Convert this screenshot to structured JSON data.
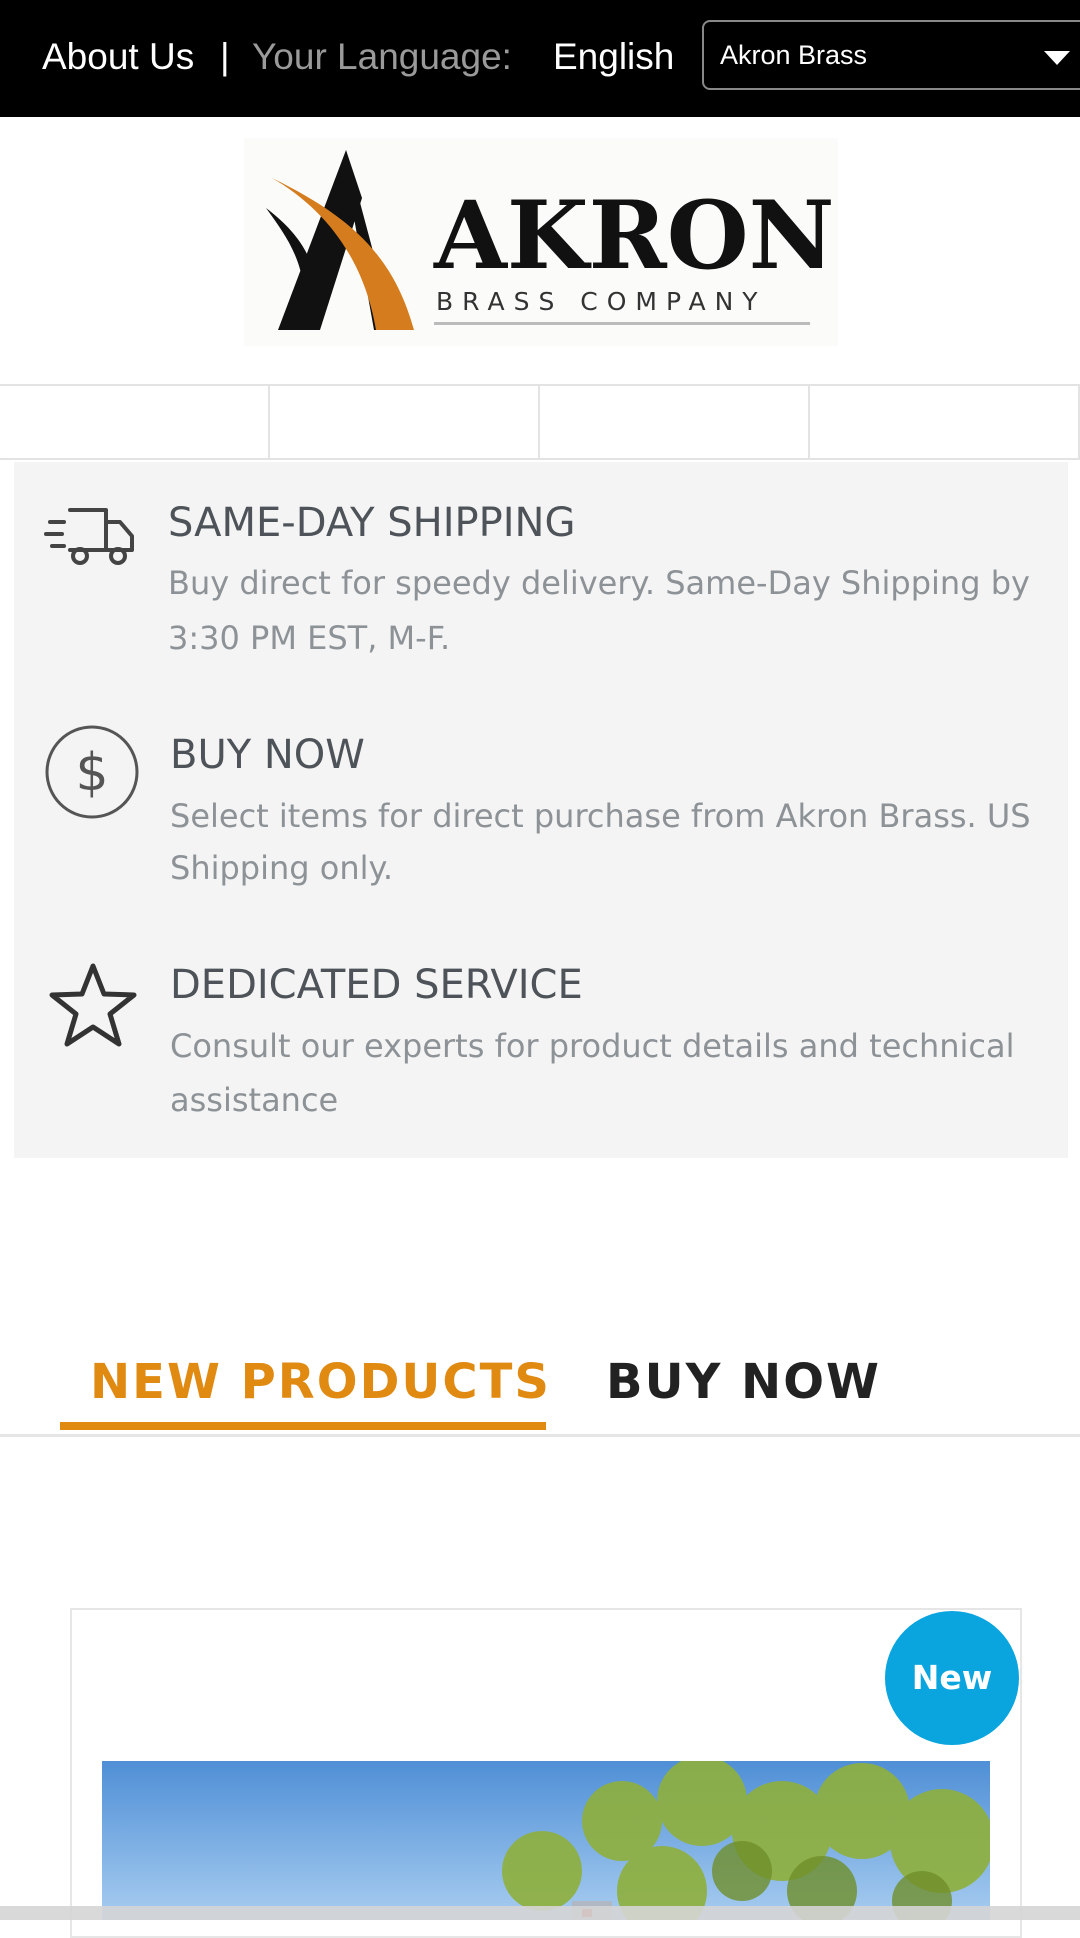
{
  "topbar": {
    "about_label": "About Us",
    "separator": "|",
    "language_label": "Your Language:",
    "language_value": "English",
    "brand_select_value": "Akron Brass"
  },
  "logo": {
    "name": "AKRON",
    "tagline": "BRASS COMPANY"
  },
  "features": [
    {
      "icon": "truck-icon",
      "title": "SAME-DAY SHIPPING",
      "desc_line1": "Buy direct for speedy delivery. Same-Day Shipping by",
      "desc_line2": "3:30 PM EST, M-F."
    },
    {
      "icon": "dollar-circle-icon",
      "title": "BUY NOW",
      "desc_line1": "Select items for direct purchase from Akron Brass. US",
      "desc_line2": "Shipping only."
    },
    {
      "icon": "star-icon",
      "title": "DEDICATED SERVICE",
      "desc_line1": "Consult our experts for product details and technical",
      "desc_line2": "assistance"
    }
  ],
  "tabs": [
    {
      "label": "NEW PRODUCTS",
      "active": true
    },
    {
      "label": "BUY NOW",
      "active": false
    }
  ],
  "product": {
    "badge": "New"
  },
  "colors": {
    "accent": "#e08a12",
    "badge": "#0aa5df",
    "topbar": "#000000",
    "feature_bg": "#f4f4f4"
  }
}
